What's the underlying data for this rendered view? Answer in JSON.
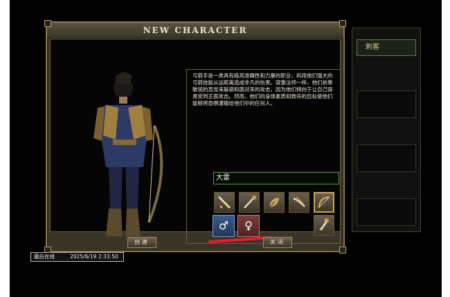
{
  "dialog": {
    "title": "NEW CHARACTER",
    "class_description": "弓箭手是一类具有极高准确性和力量的职业，利用他们强大的弓箭技能从远距离造成非凡的伤害。就像法师一样，他们依靠敏锐的直觉来躲避和面对来的攻击，因为他们倾向于让自己容易受到正面攻击。然而，他们的身体素质和致命的目标使他们能够将恐惧灌输给他们中的任何人。",
    "name_value": "大雷",
    "class_icons": [
      "warrior-sword-icon",
      "wizard-staff-icon",
      "taoist-fan-icon",
      "assassin-blade-icon",
      "archer-bow-icon",
      "monk-weapon-icon"
    ],
    "selected_class": "archer",
    "gender_icons": [
      "male-symbol-icon",
      "female-symbol-icon"
    ],
    "create_label": "创建",
    "close_label": "关闭"
  },
  "background_panel": {
    "tab_label": "刺客"
  },
  "status": {
    "label": "最后在线",
    "timestamp": "2025/6/19 2:33:50"
  },
  "colors": {
    "name_border": "#58a050",
    "annotation_underline": "#ee1b2c",
    "male_button": "#2f4a78",
    "female_button": "#6b3030"
  }
}
